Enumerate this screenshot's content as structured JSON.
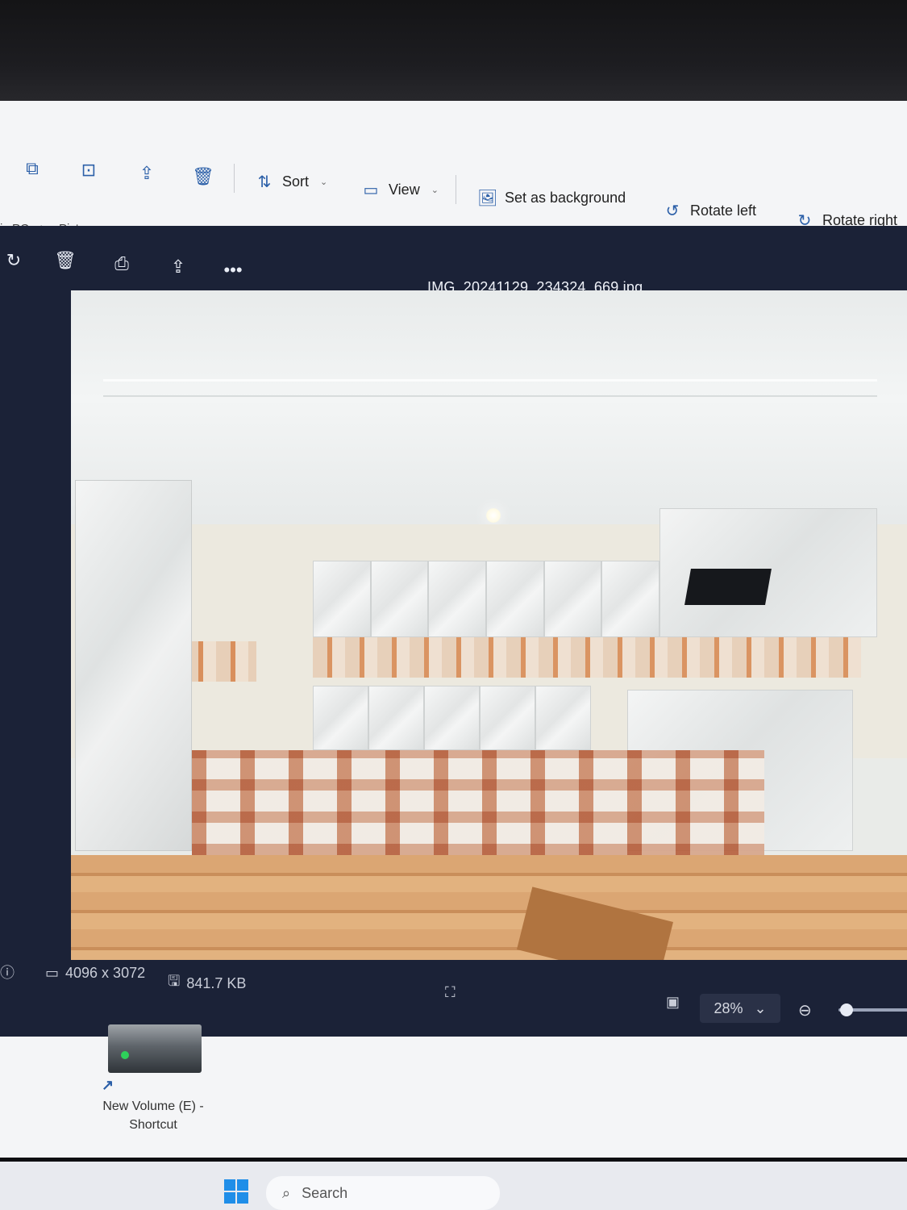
{
  "toolbar": {
    "sort_label": "Sort",
    "view_label": "View",
    "set_background_label": "Set as background",
    "rotate_left_label": "Rotate left",
    "rotate_right_label": "Rotate right"
  },
  "address_bar": {
    "crumbs": [
      "is PC",
      ">",
      "Pictures"
    ]
  },
  "viewer": {
    "title": "IMG_20241129_234324_669.jpg",
    "dimensions": "4096 x 3072",
    "file_size": "841.7 KB",
    "zoom": "28%"
  },
  "desktop": {
    "shortcut_label_line1": "New Volume (E) -",
    "shortcut_label_line2": "Shortcut"
  },
  "taskbar": {
    "search_placeholder": "Search"
  },
  "colors": {
    "viewer_bg": "#1b2237",
    "explorer_bg": "#f4f5f7",
    "accent": "#2b5fa8"
  }
}
